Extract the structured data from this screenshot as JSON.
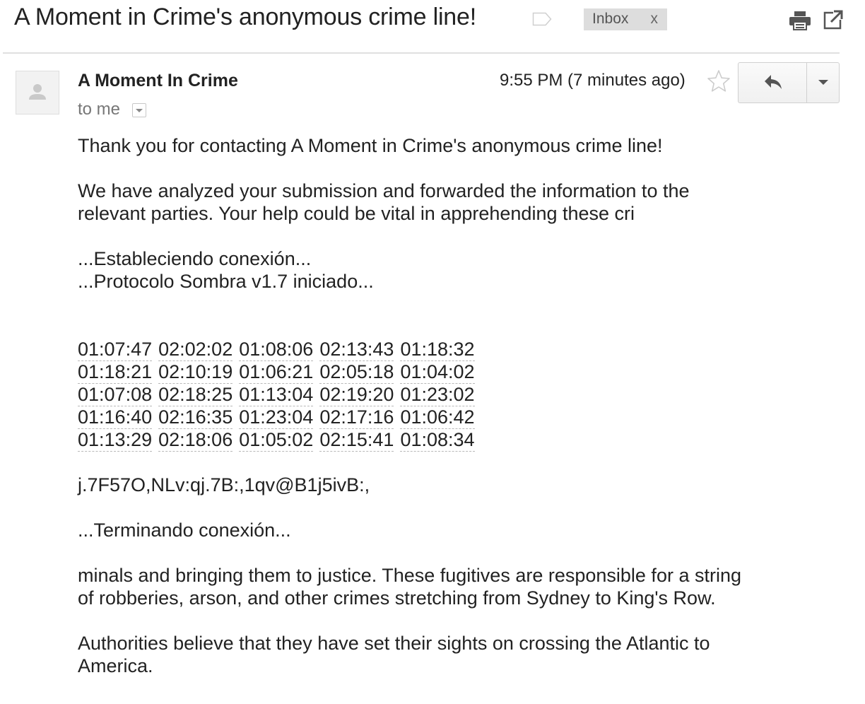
{
  "subject": {
    "title": "A Moment in Crime's anonymous crime line!",
    "label": "Inbox",
    "label_remove": "x"
  },
  "icons": {
    "label_tag": "label-tag-icon",
    "print": "print-icon",
    "popout": "open-in-new-window-icon",
    "avatar": "default-avatar-icon",
    "star": "star-icon",
    "reply": "reply-arrow-icon",
    "more": "chevron-down-icon"
  },
  "message": {
    "sender": "A Moment In Crime",
    "recipient": "to me",
    "timestamp": "9:55 PM (7 minutes ago)"
  },
  "body": {
    "greeting": "Thank you for contacting A Moment in Crime's anonymous crime line!",
    "para1_line1": "We have analyzed your submission and forwarded the information to the",
    "para1_line2": "relevant parties. Your help could be vital in apprehending these cri",
    "status1": "...Estableciendo conexión...",
    "status2": "...Protocolo Sombra v1.7 iniciado...",
    "codes": [
      [
        "01:07:47",
        "02:02:02",
        "01:08:06",
        "02:13:43",
        "01:18:32"
      ],
      [
        "01:18:21",
        "02:10:19",
        "01:06:21",
        "02:05:18",
        "01:04:02"
      ],
      [
        "01:07:08",
        "02:18:25",
        "01:13:04",
        "02:19:20",
        "01:23:02"
      ],
      [
        "01:16:40",
        "02:16:35",
        "01:23:04",
        "02:17:16",
        "01:06:42"
      ],
      [
        "01:13:29",
        "02:18:06",
        "01:05:02",
        "02:15:41",
        "01:08:34"
      ]
    ],
    "cipher": "j.7F57O,NLv:qj.7B:,1qv@B1j5ivB:,",
    "status3": "...Terminando conexión...",
    "para2_line1": "minals and bringing them to justice. These fugitives are responsible for a string",
    "para2_line2": "of robberies, arson, and other crimes stretching from Sydney to King's Row.",
    "para3_line1": "Authorities believe that they have set their sights on crossing the Atlantic to",
    "para3_line2": "America."
  },
  "colors": {
    "chip_bg": "#dddddd",
    "text": "#222222",
    "muted": "#777777",
    "divider": "#e0e0e0"
  }
}
